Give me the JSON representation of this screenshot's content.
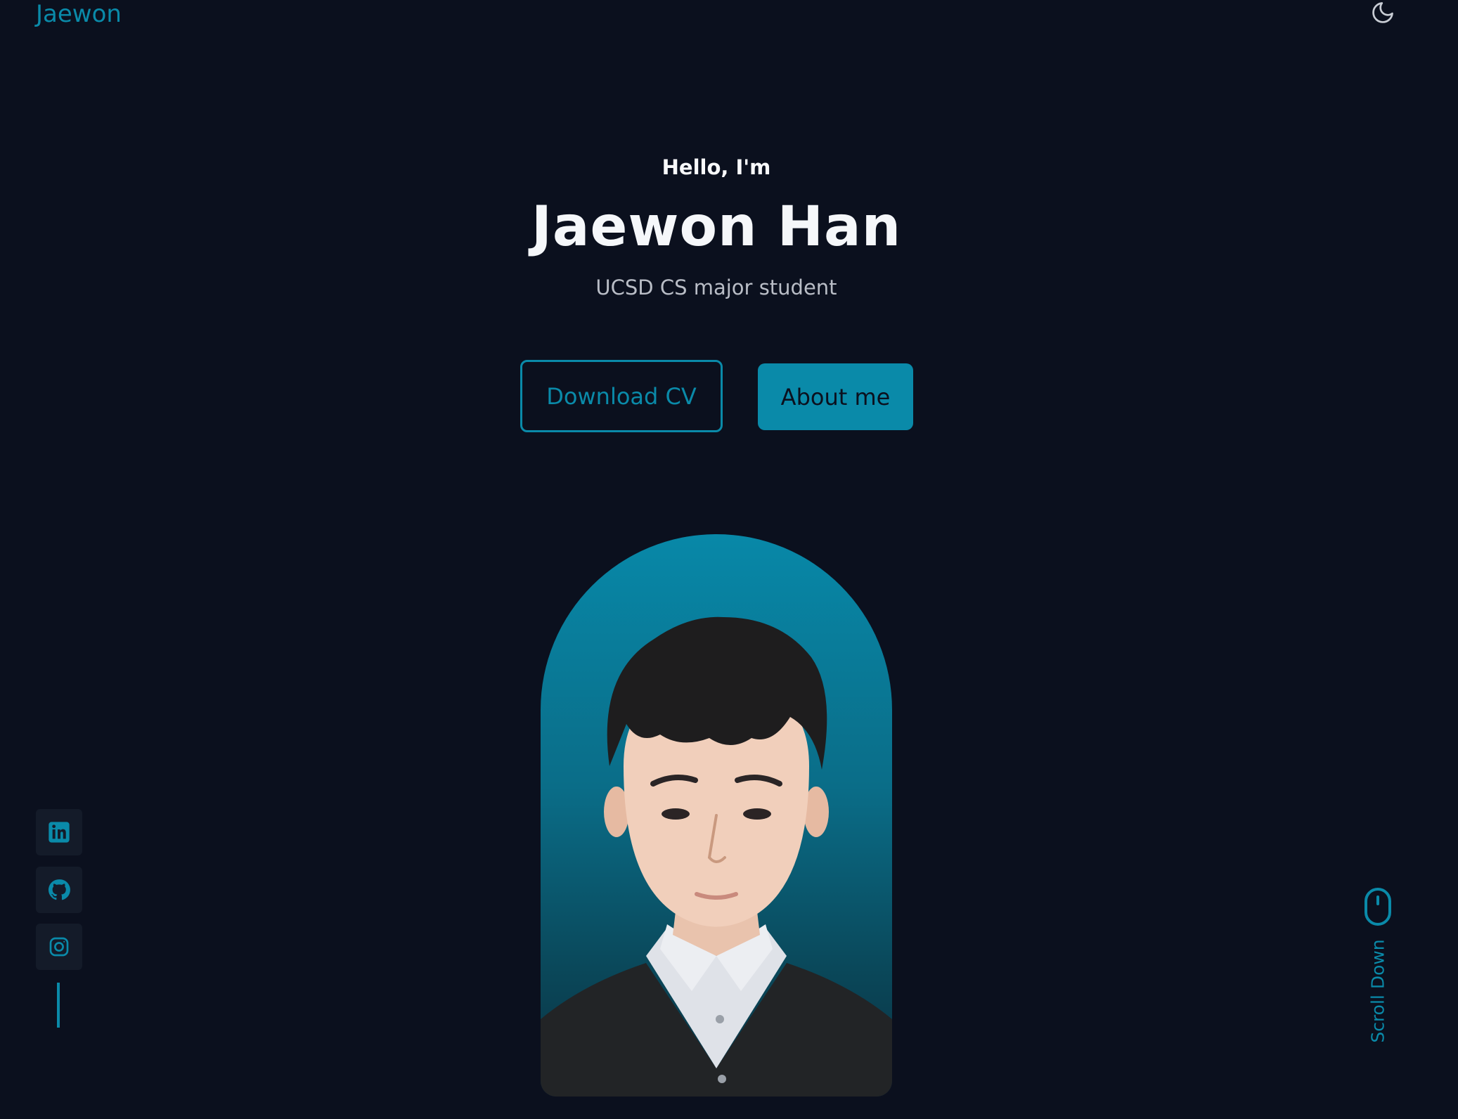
{
  "header": {
    "logo": "Jaewon",
    "theme_toggle_icon": "moon-icon"
  },
  "hero": {
    "greeting": "Hello, I'm",
    "name": "Jaewon Han",
    "role": "UCSD CS major student",
    "buttons": {
      "download_cv": "Download CV",
      "about_me": "About me"
    },
    "portrait_alt": "portrait-photo"
  },
  "social": {
    "items": [
      {
        "icon": "linkedin-icon"
      },
      {
        "icon": "github-icon"
      },
      {
        "icon": "instagram-icon"
      }
    ]
  },
  "scroll": {
    "label": "Scroll Down",
    "icon": "mouse-icon"
  },
  "colors": {
    "background": "#0b101e",
    "accent": "#0a8aa9",
    "text": "#f5f7fa",
    "muted": "#b9bdc6",
    "social_bg": "#141b29"
  }
}
